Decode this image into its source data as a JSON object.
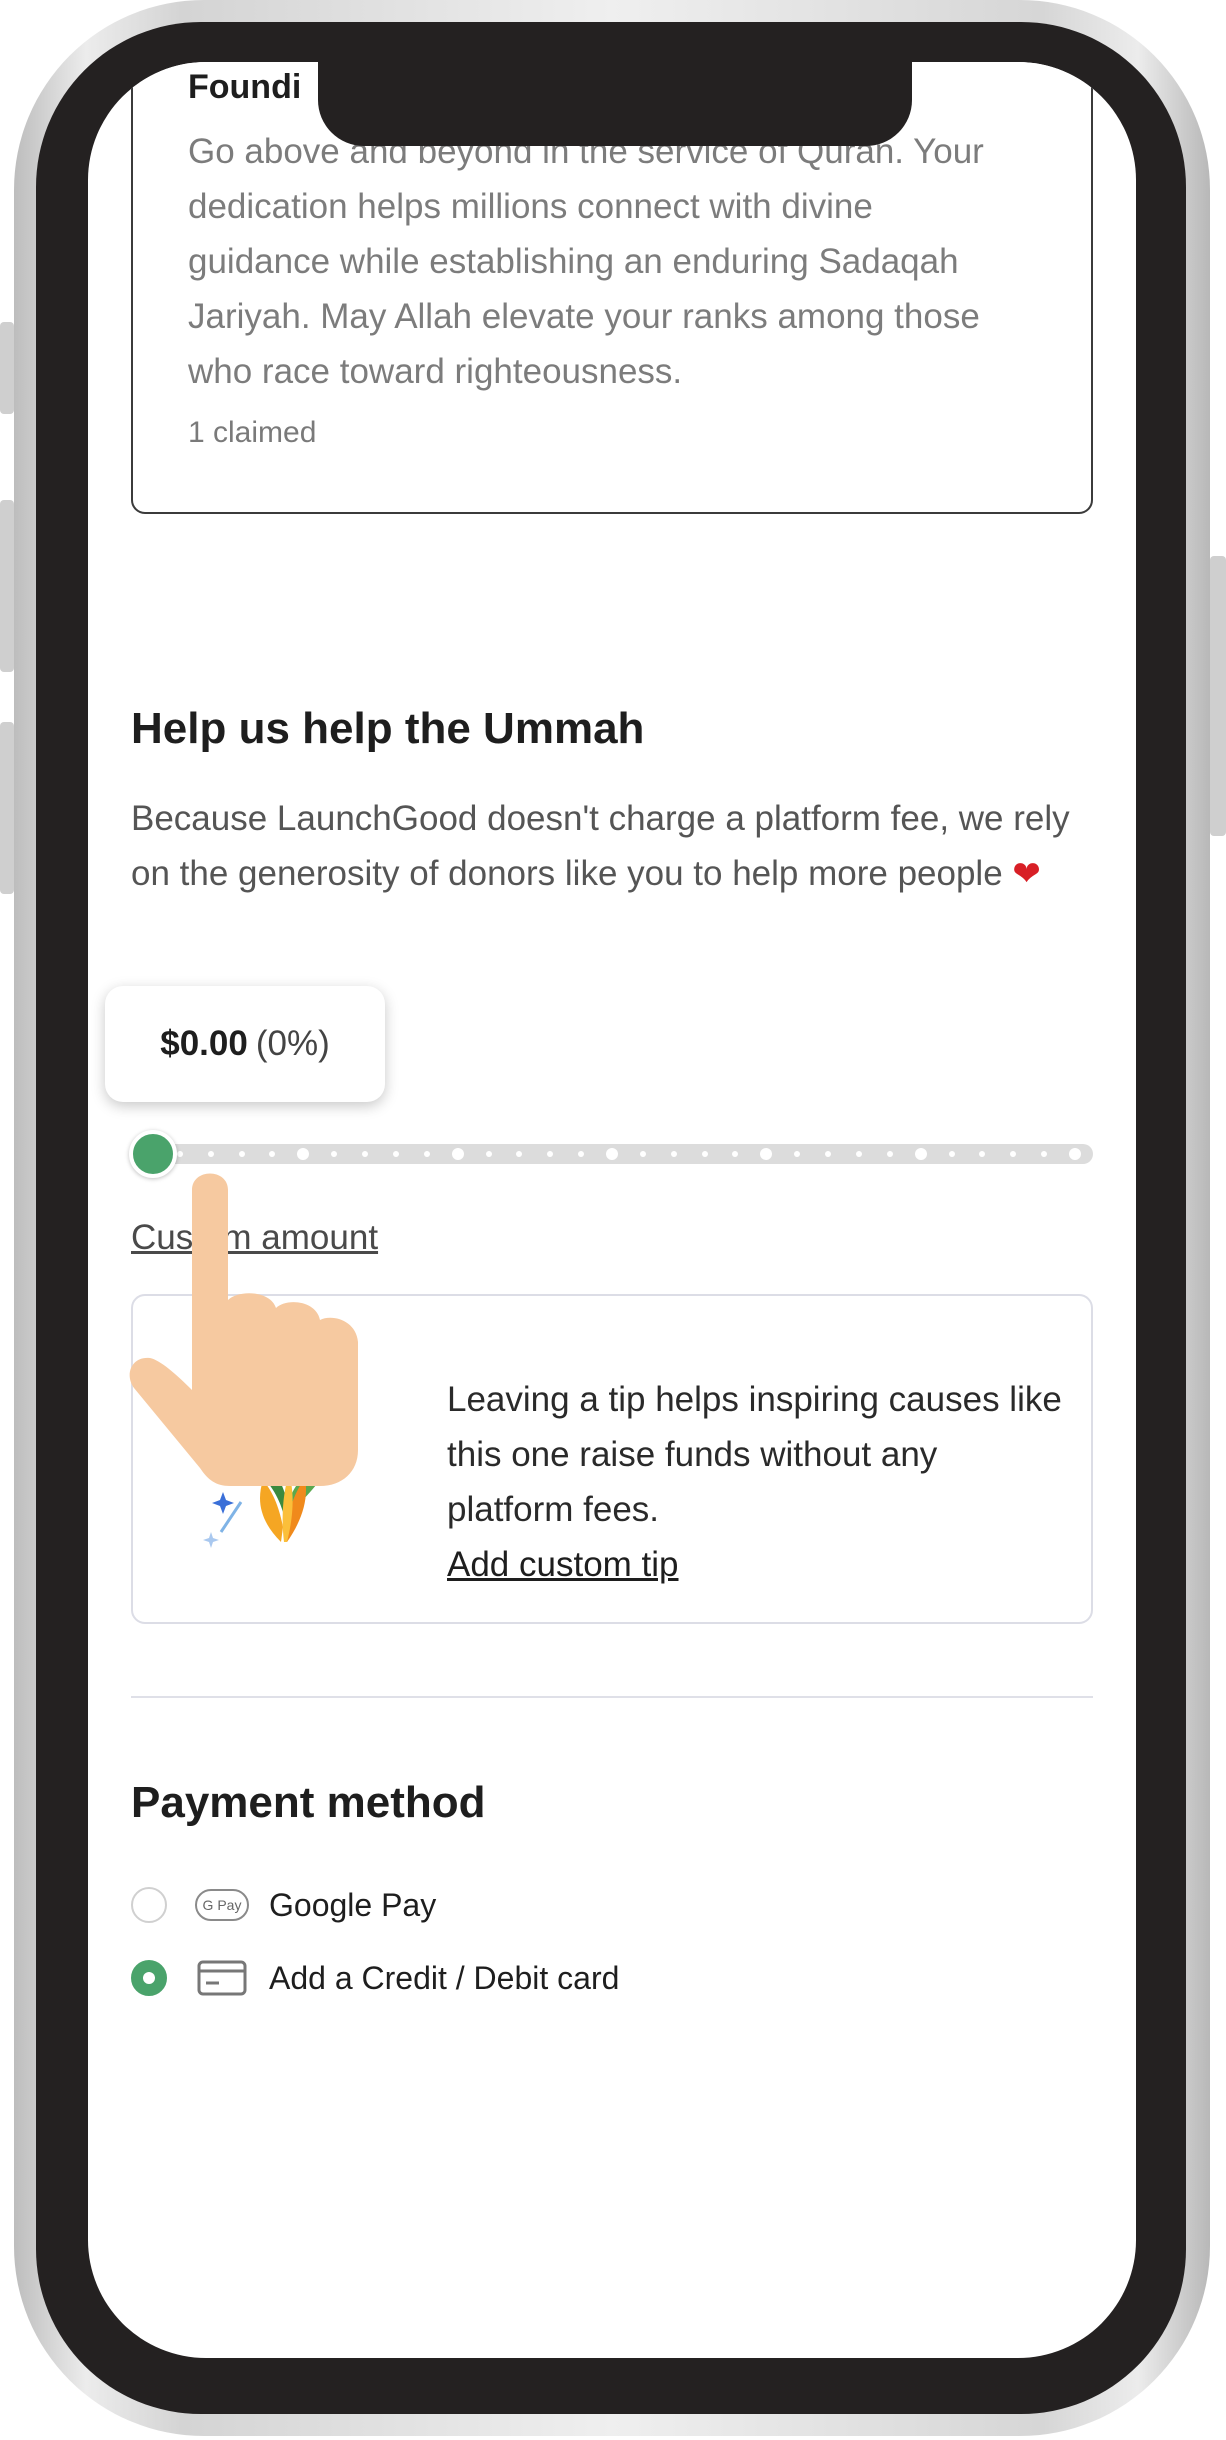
{
  "founding": {
    "title": "Foundi",
    "description": "Go above and beyond in the service of Quran. Your dedication helps millions connect with divine guidance while establishing an enduring Sadaqah Jariyah. May Allah elevate your ranks among those who race toward righteousness.",
    "claimed": "1 claimed"
  },
  "help": {
    "title": "Help us help the Ummah",
    "description": "Because LaunchGood doesn't charge a platform fee, we rely on the generosity of donors like you to help more people",
    "heart_icon": "heart-icon"
  },
  "tip": {
    "amount": "$0.00",
    "percent": "(0%)",
    "slider_fraction": 0,
    "custom_amount_label": "Custom amount",
    "card_text": "Leaving a tip helps inspiring causes like this one raise funds without any platform fees.",
    "add_custom_tip": "Add custom tip"
  },
  "payment": {
    "title": "Payment method",
    "options": [
      {
        "label": "Google Pay",
        "icon": "google-pay-icon",
        "selected": false
      },
      {
        "label": "Add a Credit / Debit card",
        "icon": "credit-card-icon",
        "selected": true
      }
    ]
  },
  "colors": {
    "accent_green": "#4aa36b",
    "heart_red": "#d81f26",
    "frame_dark": "#242121"
  }
}
